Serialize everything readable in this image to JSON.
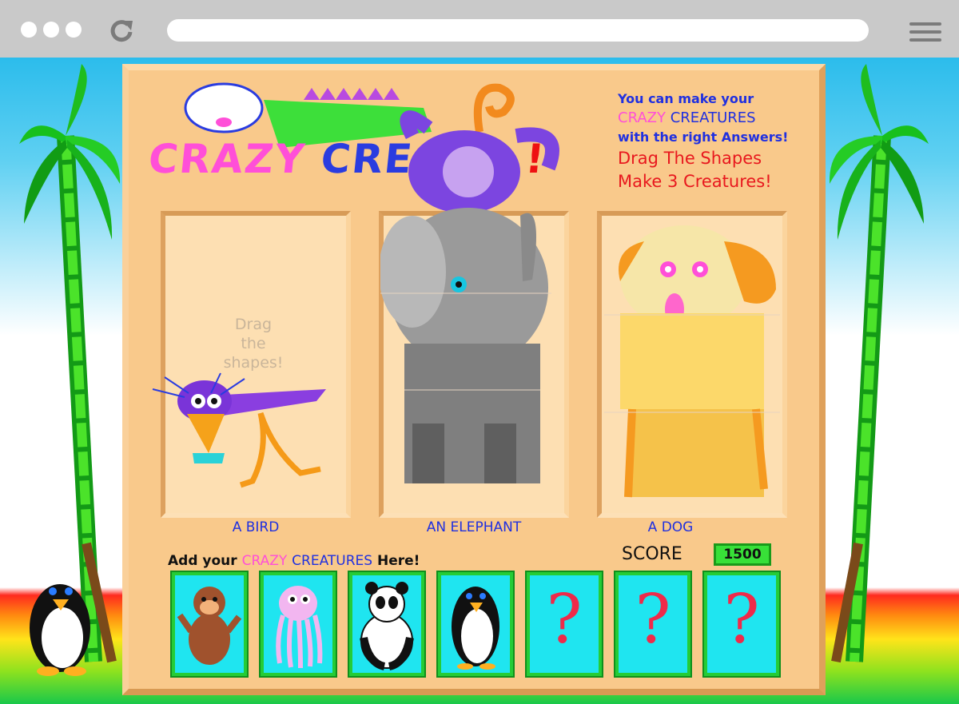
{
  "browser": {
    "reload_icon": "reload-icon",
    "menu_icon": "hamburger-menu-icon"
  },
  "game": {
    "title_part1": "CRAZY",
    "title_part2": "CREA",
    "title_part3": "!",
    "instructions": {
      "line1": "You can make your",
      "crazy": "CRAZY",
      "creatures": "CREATURES",
      "line3": "with the right Answers!",
      "line4": "Drag The Shapes",
      "line5": "Make 3 Creatures!"
    },
    "drop_hint_1": "Drag",
    "drop_hint_2": "the",
    "drop_hint_3": "shapes!",
    "slots": [
      {
        "label": "A BIRD"
      },
      {
        "label": "AN ELEPHANT"
      },
      {
        "label": "A DOG"
      }
    ],
    "add_prefix": "Add your",
    "add_crazy": "CRAZY",
    "add_creatures": "CREATURES",
    "add_suffix": "Here!",
    "score_label": "SCORE",
    "score_value": "1500",
    "cards": [
      {
        "name": "monkey",
        "locked": false
      },
      {
        "name": "octopus",
        "locked": false
      },
      {
        "name": "panda",
        "locked": false
      },
      {
        "name": "penguin",
        "locked": false
      },
      {
        "name": "mystery",
        "locked": true,
        "symbol": "?"
      },
      {
        "name": "mystery",
        "locked": true,
        "symbol": "?"
      },
      {
        "name": "mystery",
        "locked": true,
        "symbol": "?"
      }
    ]
  },
  "colors": {
    "board": "#f9c98b",
    "card": "#1fe5f0",
    "card_border": "#25cc36",
    "score_box": "#38e038"
  }
}
